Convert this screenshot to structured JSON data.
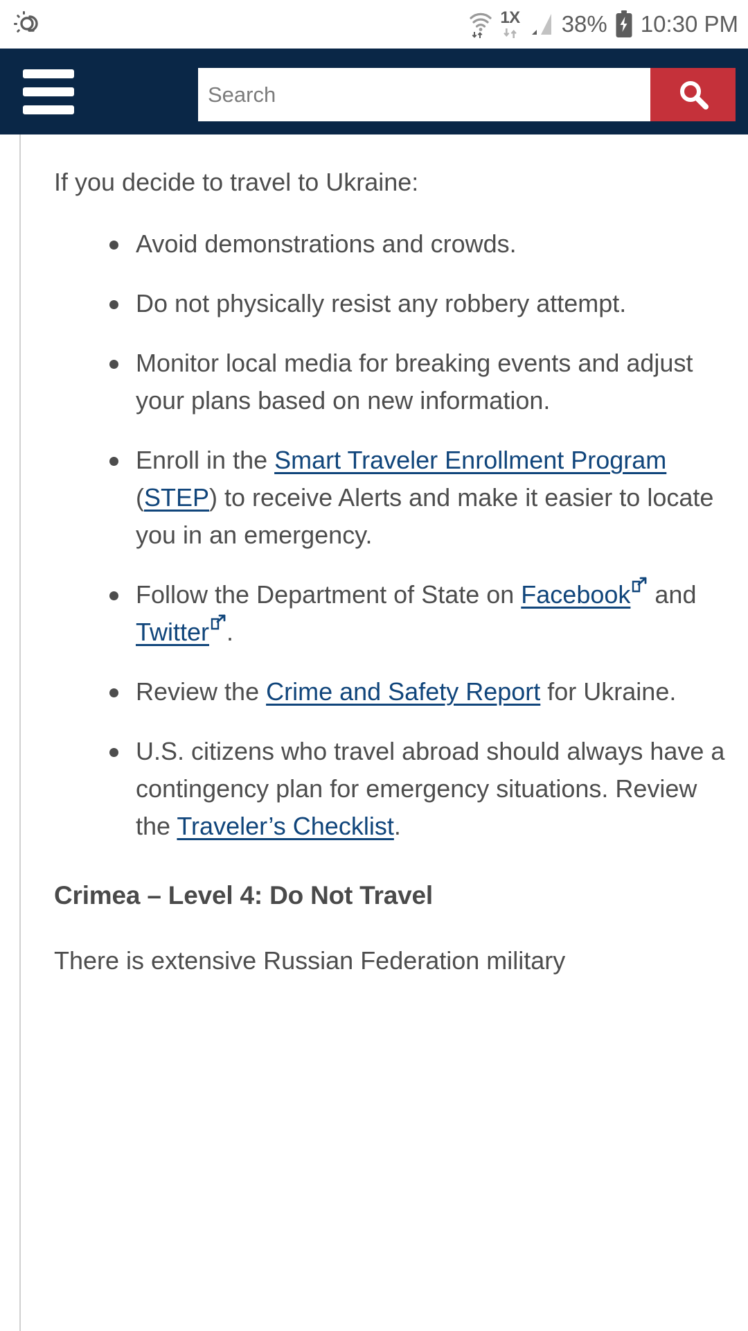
{
  "statusbar": {
    "weather_icon": "weather-sun-cloud-icon",
    "wifi_icon": "wifi-icon",
    "network_label": "1X",
    "network_data_icon": "data-transfer-icon",
    "signal_icon": "cellular-signal-icon",
    "battery_percent": "38%",
    "battery_icon": "battery-charging-icon",
    "time": "10:30 PM"
  },
  "header": {
    "menu_icon": "hamburger-menu-icon",
    "search_value": "",
    "search_placeholder": "Search",
    "search_button_icon": "search-icon",
    "navy": "#0a2747",
    "red": "#c5313a"
  },
  "article": {
    "intro": "If you decide to travel to Ukraine:",
    "bullets": [
      {
        "parts": [
          {
            "type": "text",
            "text": "Avoid demonstrations and crowds."
          }
        ]
      },
      {
        "parts": [
          {
            "type": "text",
            "text": "Do not physically resist any robbery attempt."
          }
        ]
      },
      {
        "parts": [
          {
            "type": "text",
            "text": "Monitor local media for breaking events and adjust your plans based on new information."
          }
        ]
      },
      {
        "parts": [
          {
            "type": "text",
            "text": "Enroll in the "
          },
          {
            "type": "link",
            "text": "Smart Traveler Enrollment Program"
          },
          {
            "type": "text",
            "text": " ("
          },
          {
            "type": "link",
            "text": "STEP"
          },
          {
            "type": "text",
            "text": ") to receive Alerts and make it easier to locate you in an emergency."
          }
        ]
      },
      {
        "parts": [
          {
            "type": "text",
            "text": "Follow the Department of State on "
          },
          {
            "type": "link",
            "text": "Facebook",
            "external": true
          },
          {
            "type": "text",
            "text": " and "
          },
          {
            "type": "link",
            "text": "Twitter",
            "external": true
          },
          {
            "type": "text",
            "text": "."
          }
        ]
      },
      {
        "parts": [
          {
            "type": "text",
            "text": "Review the "
          },
          {
            "type": "link",
            "text": "Crime and Safety Report"
          },
          {
            "type": "text",
            "text": " for Ukraine."
          }
        ]
      },
      {
        "parts": [
          {
            "type": "text",
            "text": "U.S. citizens who travel abroad should always have a contingency plan for emergency situations. Review the "
          },
          {
            "type": "link",
            "text": "Traveler’s Checklist"
          },
          {
            "type": "text",
            "text": "."
          }
        ]
      }
    ],
    "section_heading": "Crimea – Level 4: Do Not Travel",
    "section_body": "There is extensive Russian Federation military",
    "link_color": "#10457b",
    "text_color": "#4d4d4d"
  }
}
